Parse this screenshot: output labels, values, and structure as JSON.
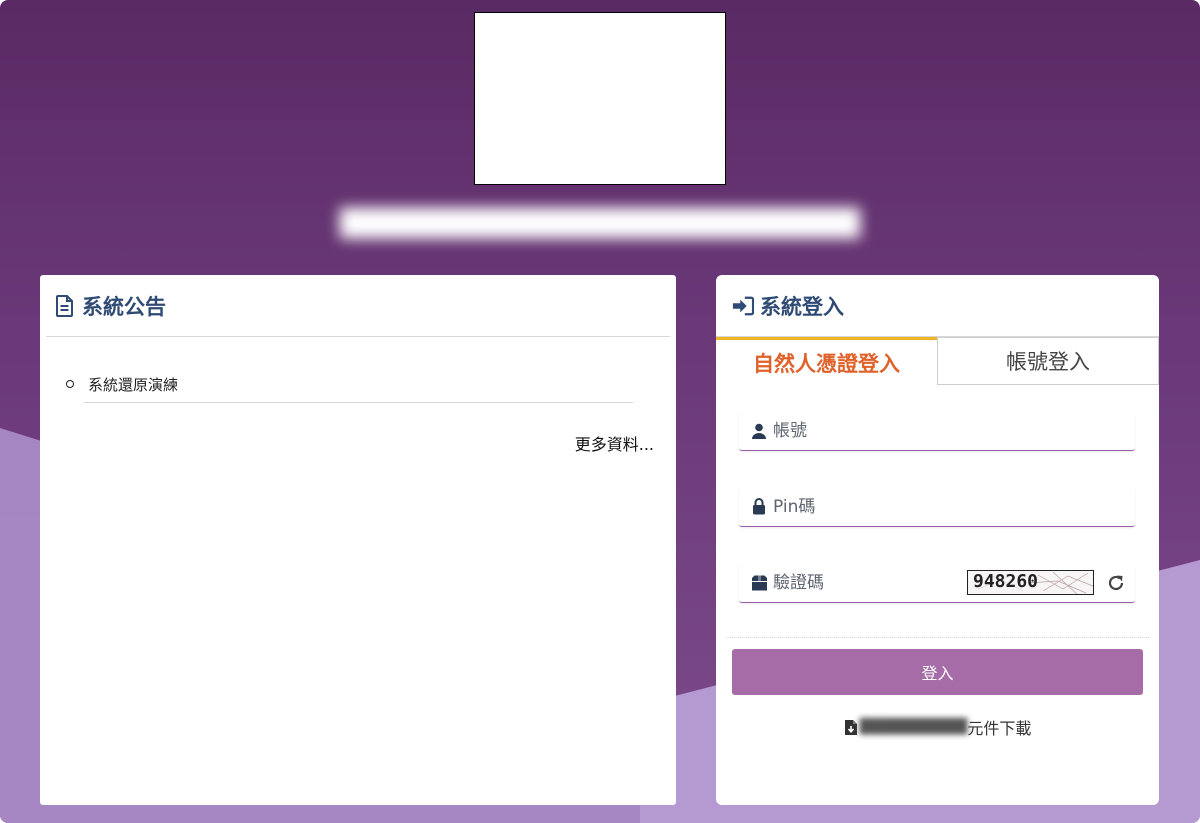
{
  "header": {
    "org_title_blurred": "██████████████████████████"
  },
  "announcements": {
    "title": "系統公告",
    "items": [
      {
        "text": "系統還原演練"
      }
    ],
    "more_label": "更多資料..."
  },
  "login": {
    "title": "系統登入",
    "tabs": [
      {
        "label": "自然人憑證登入",
        "active": true
      },
      {
        "label": "帳號登入",
        "active": false
      }
    ],
    "account_placeholder": "帳號",
    "pin_placeholder": "Pin碼",
    "captcha_placeholder": "驗證碼",
    "captcha_value": "948260",
    "submit_label": "登入",
    "download_prefix_blurred": "██████████",
    "download_suffix": "元件下載"
  },
  "colors": {
    "header_text": "#2e4a75",
    "active_tab": "#e0612a",
    "active_tab_border": "#f0b429",
    "login_button": "#a66ca8",
    "field_underline": "#9b5cb0"
  },
  "icons": {
    "announce": "file-text-icon",
    "login": "sign-in-icon",
    "account": "user-icon",
    "pin": "lock-icon",
    "captcha": "box-icon",
    "refresh": "refresh-icon",
    "download": "file-download-icon"
  }
}
